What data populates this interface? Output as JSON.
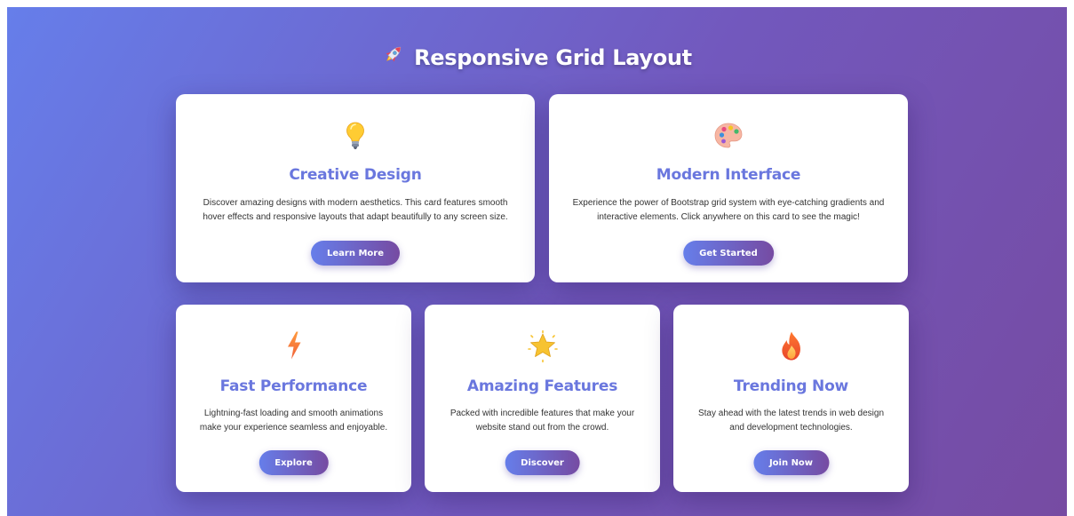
{
  "page": {
    "title": "Responsive Grid Layout",
    "title_icon": "rocket-icon"
  },
  "cards": [
    {
      "icon": "lightbulb-icon",
      "title": "Creative Design",
      "text": "Discover amazing designs with modern aesthetics. This card features smooth hover effects and responsive layouts that adapt beautifully to any screen size.",
      "button": "Learn More"
    },
    {
      "icon": "palette-icon",
      "title": "Modern Interface",
      "text": "Experience the power of Bootstrap grid system with eye-catching gradients and interactive elements. Click anywhere on this card to see the magic!",
      "button": "Get Started"
    },
    {
      "icon": "lightning-icon",
      "title": "Fast Performance",
      "text": "Lightning-fast loading and smooth animations make your experience seamless and enjoyable.",
      "button": "Explore"
    },
    {
      "icon": "star-icon",
      "title": "Amazing Features",
      "text": "Packed with incredible features that make your website stand out from the crowd.",
      "button": "Discover"
    },
    {
      "icon": "fire-icon",
      "title": "Trending Now",
      "text": "Stay ahead with the latest trends in web design and development technologies.",
      "button": "Join Now"
    }
  ],
  "colors": {
    "gradient_start": "#667eea",
    "gradient_end": "#764ba2",
    "card_title": "#6a77de"
  }
}
